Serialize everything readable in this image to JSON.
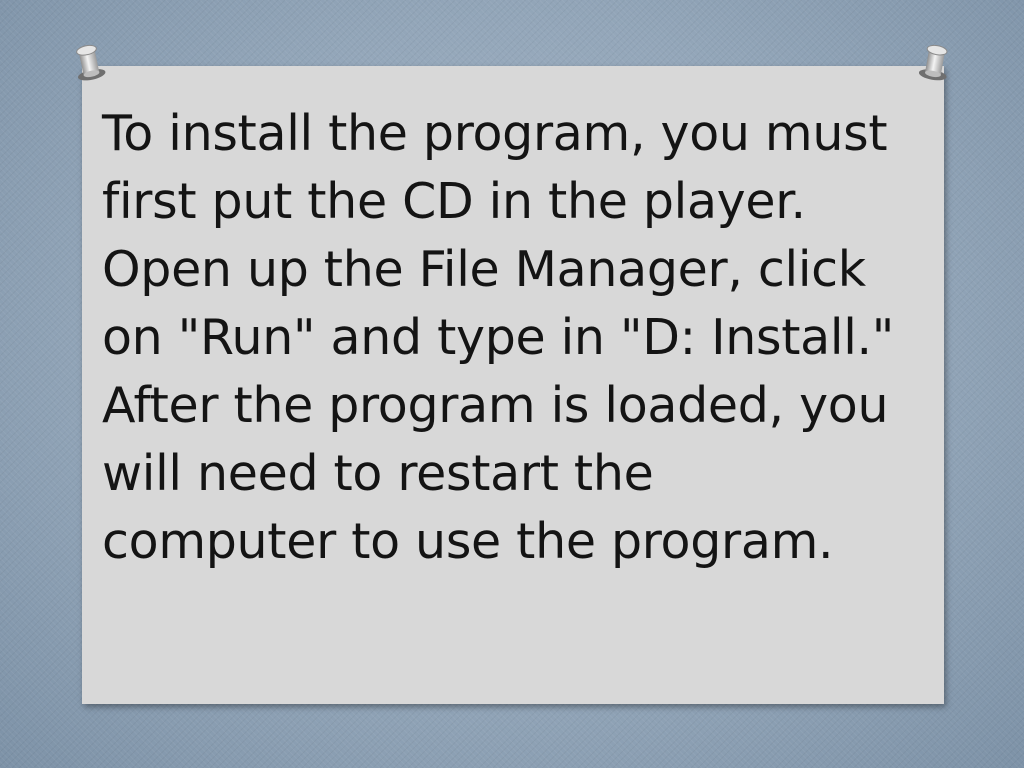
{
  "slide": {
    "body_text": "To install the program, you must first put the CD in the player. Open up the File Manager, click on \"Run\" and type in \"D: Install.\" After the program is loaded, you will need to restart the computer to use the program."
  },
  "colors": {
    "background": "#93a6b9",
    "card": "#d8d8d8",
    "text": "#141414"
  },
  "icons": [
    "pin-icon",
    "pin-icon"
  ]
}
